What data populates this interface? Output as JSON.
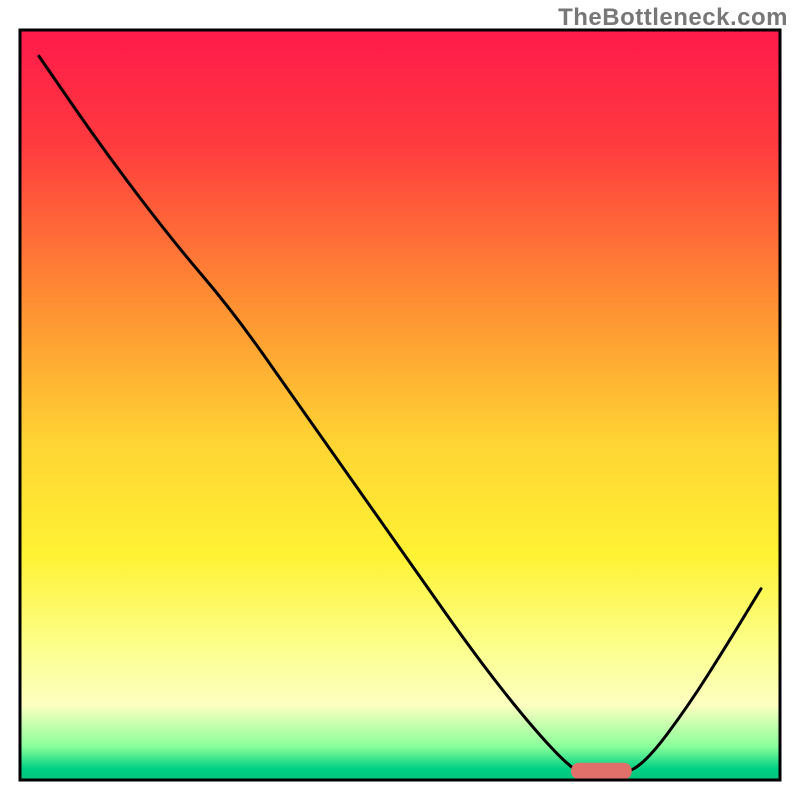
{
  "watermark": "TheBottleneck.com",
  "chart_data": {
    "type": "line",
    "title": "",
    "xlabel": "",
    "ylabel": "",
    "xlim": [
      0,
      100
    ],
    "ylim": [
      0,
      100
    ],
    "gradient_stops": [
      {
        "offset": 0.0,
        "color": "#ff1a4b"
      },
      {
        "offset": 0.15,
        "color": "#ff3a3f"
      },
      {
        "offset": 0.35,
        "color": "#ff8a33"
      },
      {
        "offset": 0.55,
        "color": "#ffd433"
      },
      {
        "offset": 0.7,
        "color": "#fff233"
      },
      {
        "offset": 0.82,
        "color": "#fcff8a"
      },
      {
        "offset": 0.9,
        "color": "#fdffc0"
      },
      {
        "offset": 0.955,
        "color": "#8aff9a"
      },
      {
        "offset": 0.985,
        "color": "#00d084"
      },
      {
        "offset": 1.0,
        "color": "#00c47a"
      }
    ],
    "curve": [
      {
        "x": 2.5,
        "y": 96.5
      },
      {
        "x": 11.0,
        "y": 84.0
      },
      {
        "x": 20.0,
        "y": 72.0
      },
      {
        "x": 28.0,
        "y": 62.5
      },
      {
        "x": 36.0,
        "y": 51.0
      },
      {
        "x": 44.0,
        "y": 39.5
      },
      {
        "x": 52.0,
        "y": 28.0
      },
      {
        "x": 60.0,
        "y": 16.5
      },
      {
        "x": 67.0,
        "y": 7.5
      },
      {
        "x": 72.5,
        "y": 1.5
      },
      {
        "x": 75.0,
        "y": 0.5
      },
      {
        "x": 79.0,
        "y": 0.5
      },
      {
        "x": 82.5,
        "y": 2.5
      },
      {
        "x": 88.0,
        "y": 10.0
      },
      {
        "x": 93.0,
        "y": 18.0
      },
      {
        "x": 97.5,
        "y": 25.5
      }
    ],
    "optimal_marker": {
      "x_start": 72.5,
      "x_end": 80.5,
      "y": 1.2,
      "color": "#e2706a",
      "thickness": 2.2
    },
    "frame": {
      "inset_top": 30,
      "inset_left": 20,
      "inset_right": 20,
      "inset_bottom": 20,
      "stroke": "#000000",
      "stroke_width": 3
    }
  }
}
